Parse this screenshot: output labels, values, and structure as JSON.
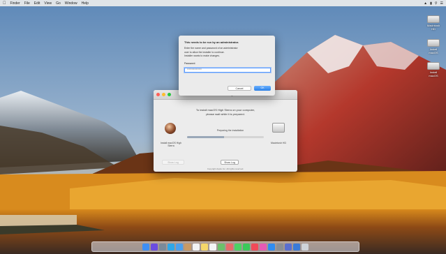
{
  "menubar": {
    "apple_icon": "apple-icon",
    "items": [
      "Finder",
      "File",
      "Edit",
      "View",
      "Go",
      "Window",
      "Help"
    ],
    "right_icons": [
      "wifi-icon",
      "battery-icon",
      "spotlight-icon",
      "notification-center-icon"
    ]
  },
  "desktop_disks": [
    {
      "label": "Macintosh HD"
    },
    {
      "label": "Install macOS"
    },
    {
      "label": "Install macOS"
    }
  ],
  "installer_window": {
    "title": "Install macOS High Sierra",
    "message_line1": "To install macOS High Sierra on your computer,",
    "message_line2": "please wait while it is prepared.",
    "app_label": "Install macOS High Sierra",
    "progress_label": "Preparing the installation",
    "progress_fraction": 0.48,
    "disk_label": "Macintosh HD",
    "faded_button": "Show Log",
    "button": "Show Log",
    "footer": "Copyright Apple Inc. All rights reserved.",
    "colors": {
      "close": "#ff5f57",
      "minimize": "#febc2e",
      "zoom": "#28c840"
    }
  },
  "auth_dialog": {
    "heading": "This needs to be run by an administrator.",
    "para1": "Enter the name and password of an administrator",
    "para2": "user to allow the installer to continue.",
    "para3": "Installer wants to make changes.",
    "password_label": "Password:",
    "password_value": "••••••••••",
    "cancel_button": "Cancel",
    "ok_button": "OK",
    "accent": "#2a7fe6"
  },
  "dock": {
    "icons": [
      {
        "name": "finder-icon",
        "color": "#3e8ff5"
      },
      {
        "name": "siri-icon",
        "color": "#6b4ce0"
      },
      {
        "name": "launchpad-icon",
        "color": "#7a8a9a"
      },
      {
        "name": "safari-icon",
        "color": "#2ea7e8"
      },
      {
        "name": "mail-icon",
        "color": "#4aa0ee"
      },
      {
        "name": "contacts-icon",
        "color": "#c99a64"
      },
      {
        "name": "calendar-icon",
        "color": "#f2f2f2"
      },
      {
        "name": "notes-icon",
        "color": "#f5d66a"
      },
      {
        "name": "reminders-icon",
        "color": "#f4f4f4"
      },
      {
        "name": "maps-icon",
        "color": "#6cc06a"
      },
      {
        "name": "photos-icon",
        "color": "#e86a6a"
      },
      {
        "name": "messages-icon",
        "color": "#4cd364"
      },
      {
        "name": "facetime-icon",
        "color": "#3bc95a"
      },
      {
        "name": "news-icon",
        "color": "#f04a58"
      },
      {
        "name": "itunes-icon",
        "color": "#e65ab5"
      },
      {
        "name": "app-store-icon",
        "color": "#2f8cf0"
      },
      {
        "name": "system-preferences-icon",
        "color": "#8a8f95"
      },
      {
        "name": "installer-icon",
        "color": "#5a6fd0"
      },
      {
        "name": "downloads-icon",
        "color": "#3a7bd8"
      },
      {
        "name": "trash-icon",
        "color": "#cfd3d8"
      }
    ]
  }
}
